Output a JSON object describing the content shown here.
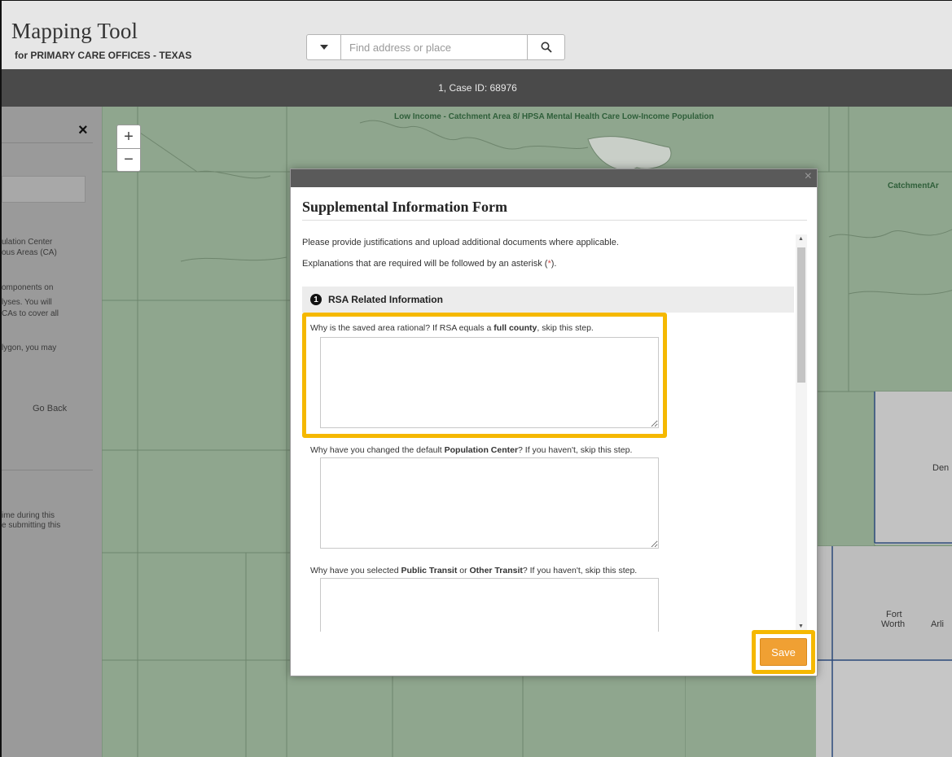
{
  "app": {
    "title": "Mapping Tool",
    "subtitle": "for PRIMARY CARE OFFICES - TEXAS"
  },
  "search": {
    "placeholder": "Find address or place",
    "dropdown_icon": "caret-down-icon",
    "button_icon": "search-icon"
  },
  "case_bar": {
    "text": "1, Case ID: 68976"
  },
  "map": {
    "labels": {
      "top_center": "Low Income - Catchment Area 8/ HPSA Mental Health Care Low-Income Population",
      "right": "CatchmentAr"
    },
    "cities": {
      "den": "Den",
      "fort_worth_1": "Fort",
      "fort_worth_2": "Worth",
      "arl": "Arli"
    },
    "zoom_in": "+",
    "zoom_out": "−"
  },
  "side_panel": {
    "close": "×",
    "lines": [
      "ulation Center",
      "ous Areas (CA)",
      "omponents on",
      "lyses. You will",
      "CAs to cover all",
      "lygon, you may"
    ],
    "go_back": "Go Back",
    "footer": [
      "ime during this",
      "e submitting this"
    ]
  },
  "modal": {
    "close": "×",
    "title": "Supplemental Information Form",
    "intro_1": "Please provide justifications and upload additional documents where applicable.",
    "intro_2_pre": "Explanations that are required will be followed by an asterisk (",
    "intro_2_ast": "*",
    "intro_2_post": ").",
    "section_number": "1",
    "section_title": "RSA Related Information",
    "questions": [
      {
        "pre": "Why is the saved area rational? If RSA equals a ",
        "bold": "full county",
        "post": ", skip this step."
      },
      {
        "pre": "Why have you changed the default ",
        "bold": "Population Center",
        "post": "? If you haven't, skip this step."
      },
      {
        "pre": "Why have you selected ",
        "bold": "Public Transit",
        "mid": " or ",
        "bold2": "Other Transit",
        "post": "? If you haven't, skip this step."
      }
    ],
    "save_label": "Save"
  },
  "colors": {
    "map_green": "#8fa68e",
    "case_bar": "#4a4a4a",
    "highlight": "#f5b800",
    "save_button": "#f0a033"
  }
}
